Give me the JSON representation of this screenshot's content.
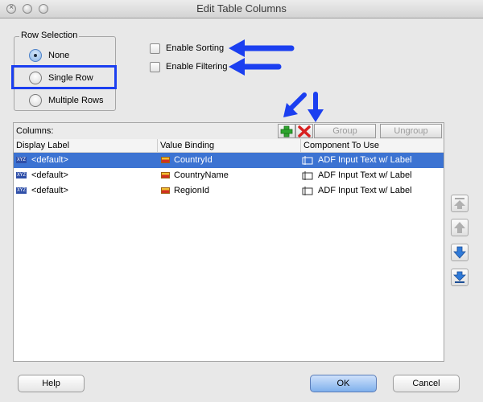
{
  "window": {
    "title": "Edit Table Columns",
    "close_glyph": "×"
  },
  "row_selection": {
    "label": "Row Selection",
    "options": [
      {
        "label": "None",
        "selected": true
      },
      {
        "label": "Single Row",
        "selected": false
      },
      {
        "label": "Multiple Rows",
        "selected": false
      }
    ]
  },
  "options": {
    "enable_sorting": "Enable Sorting",
    "enable_filtering": "Enable Filtering"
  },
  "columns": {
    "label": "Columns:",
    "group_label": "Group",
    "ungroup_label": "Ungroup",
    "headers": [
      "Display Label",
      "Value Binding",
      "Component To Use"
    ],
    "rows": [
      {
        "display_label": "<default>",
        "value_binding": "CountryId",
        "component": "ADF Input Text w/ Label"
      },
      {
        "display_label": "<default>",
        "value_binding": "CountryName",
        "component": "ADF Input Text w/ Label"
      },
      {
        "display_label": "<default>",
        "value_binding": "RegionId",
        "component": "ADF Input Text w/ Label"
      }
    ],
    "type_badge": "XYZ"
  },
  "buttons": {
    "help": "Help",
    "ok": "OK",
    "cancel": "Cancel"
  },
  "colors": {
    "annotation_blue": "#1b3ff0",
    "selection": "#3c73d2",
    "add_green": "#2ea52e",
    "delete_red": "#d82020"
  }
}
